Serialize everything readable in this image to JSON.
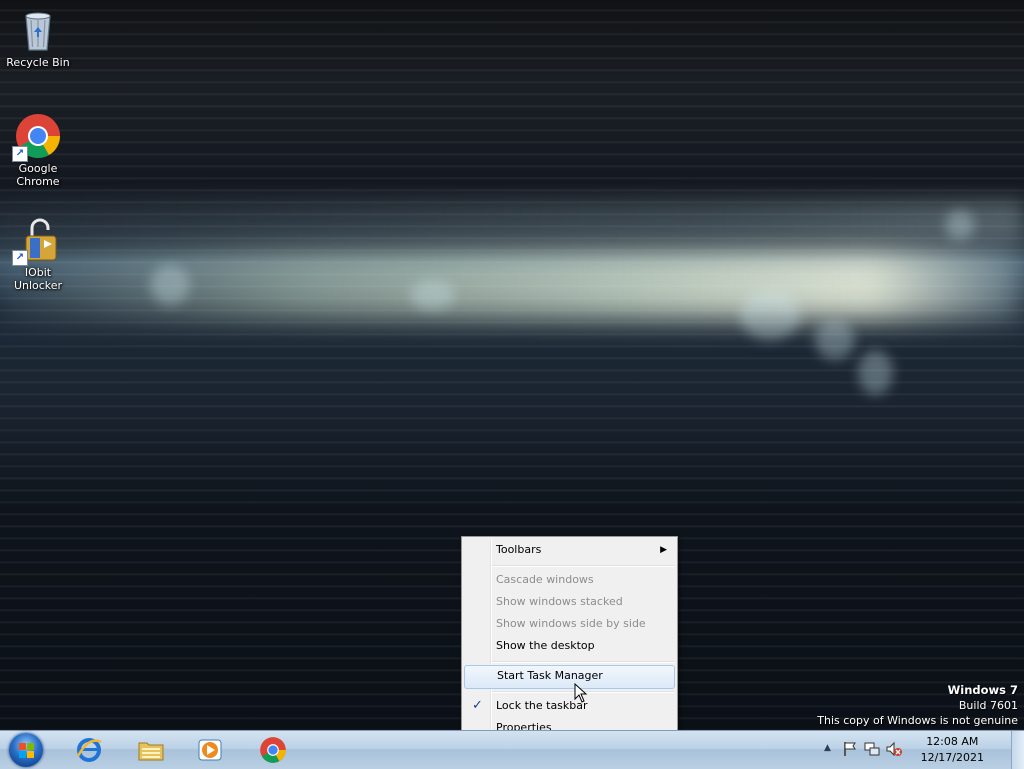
{
  "desktop": {
    "icons": [
      {
        "label": "Recycle Bin",
        "icon": "recycle-bin-icon"
      },
      {
        "label": "Google Chrome",
        "icon": "chrome-icon"
      },
      {
        "label": "IObit Unlocker",
        "icon": "unlocker-icon"
      }
    ]
  },
  "watermark": {
    "title": "Windows 7",
    "build": "Build 7601",
    "notice": "This copy of Windows is not genuine"
  },
  "context_menu": {
    "items": [
      {
        "label": "Toolbars",
        "enabled": true,
        "submenu": true
      },
      {
        "label": "Cascade windows",
        "enabled": false
      },
      {
        "label": "Show windows stacked",
        "enabled": false
      },
      {
        "label": "Show windows side by side",
        "enabled": false
      },
      {
        "label": "Show the desktop",
        "enabled": true
      },
      {
        "label": "Start Task Manager",
        "enabled": true,
        "highlighted": true
      },
      {
        "label": "Lock the taskbar",
        "enabled": true,
        "checked": true
      },
      {
        "label": "Properties",
        "enabled": true
      }
    ]
  },
  "taskbar": {
    "pinned": [
      {
        "name": "internet-explorer",
        "icon": "ie-icon"
      },
      {
        "name": "windows-explorer",
        "icon": "folder-icon"
      },
      {
        "name": "windows-media-player",
        "icon": "media-player-icon"
      },
      {
        "name": "google-chrome",
        "icon": "chrome-icon"
      }
    ],
    "tray": {
      "time": "12:08 AM",
      "date": "12/17/2021"
    }
  },
  "colors": {
    "taskbar_top": "#d3e3f1",
    "menu_bg": "#f0f0f0",
    "menu_highlight": "#dce9f8",
    "disabled_text": "#8d8d8d"
  }
}
